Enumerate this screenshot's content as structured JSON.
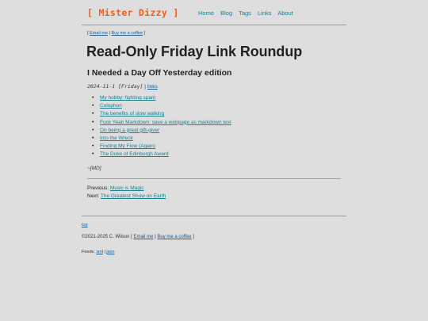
{
  "header": {
    "site_title": "[ Mister Dizzy ]",
    "nav": [
      "Home",
      "Blog",
      "Tags",
      "Links",
      "About"
    ]
  },
  "support_bar": {
    "email": "Email me",
    "coffee": "Buy me a coffee"
  },
  "post": {
    "title": "Read-Only Friday Link Roundup",
    "subtitle": "I Needed a Day Off Yesterday edition",
    "date": "2024-11-1 [Friday]",
    "tag": "links",
    "links": [
      "My hobby: fighting spam",
      "Colophon",
      "The benefits of slow walking",
      "Fuck Yeah Markdown: save a webpage as markdown text",
      "On being a great gift-giver",
      "Into the Wreck",
      "Finding My Flow (Again)",
      "The Duke of Edinburgh Award"
    ],
    "signature": "~[MD]"
  },
  "post_nav": {
    "previous_label": "Previous:",
    "previous_title": "Music is Magic",
    "next_label": "Next:",
    "next_title": "The Greatest Show on Earth"
  },
  "footer": {
    "top_link": "top",
    "copyright": "©2021-2025 C. Wilson",
    "email": "Email me",
    "coffee": "Buy me a coffee",
    "feeds_label": "Feeds:",
    "feed_rss": "xml",
    "feed_json": "json"
  }
}
